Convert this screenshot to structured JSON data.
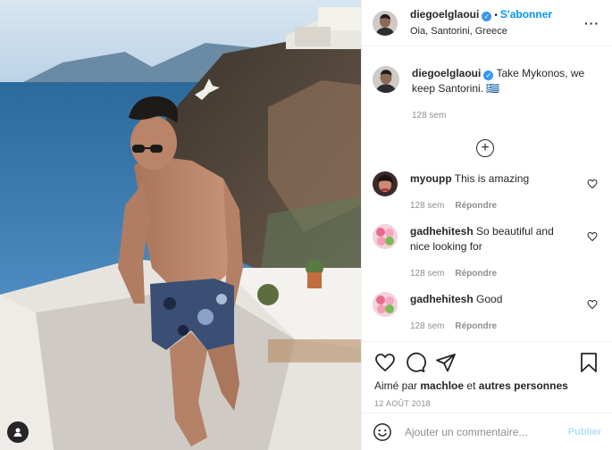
{
  "post": {
    "username": "diegoelglaoui",
    "follow_label": "S'abonner",
    "location": "Oia, Santorini, Greece",
    "more_label": "···",
    "caption": "Take Mykonos, we keep Santorini. 🇬🇷",
    "caption_time": "128 sem",
    "load_more_label": "+",
    "comments": [
      {
        "user": "myoupp",
        "text": "This is amazing",
        "time": "128 sem",
        "reply": "Répondre"
      },
      {
        "user": "gadhehitesh",
        "text": "So beautiful and nice looking for",
        "time": "128 sem",
        "reply": "Répondre"
      },
      {
        "user": "gadhehitesh",
        "text": "Good",
        "time": "128 sem",
        "reply": "Répondre"
      }
    ],
    "liked_prefix": "Aimé par",
    "liked_user": "machloe",
    "liked_and": "et",
    "liked_others": "autres personnes",
    "date": "12 AOÛT 2018",
    "comment_placeholder": "Ajouter un commentaire...",
    "publish_label": "Publier"
  },
  "icons": {
    "verified": "verified-badge-icon",
    "heart": "heart-icon",
    "comment": "comment-icon",
    "share": "paper-plane-icon",
    "save": "bookmark-icon",
    "emoji": "emoji-icon",
    "user_tag": "user-tag-icon"
  },
  "colors": {
    "accent": "#0095f6",
    "text": "#262626",
    "muted": "#8e8e8e",
    "publish_disabled": "#b2dffc"
  }
}
